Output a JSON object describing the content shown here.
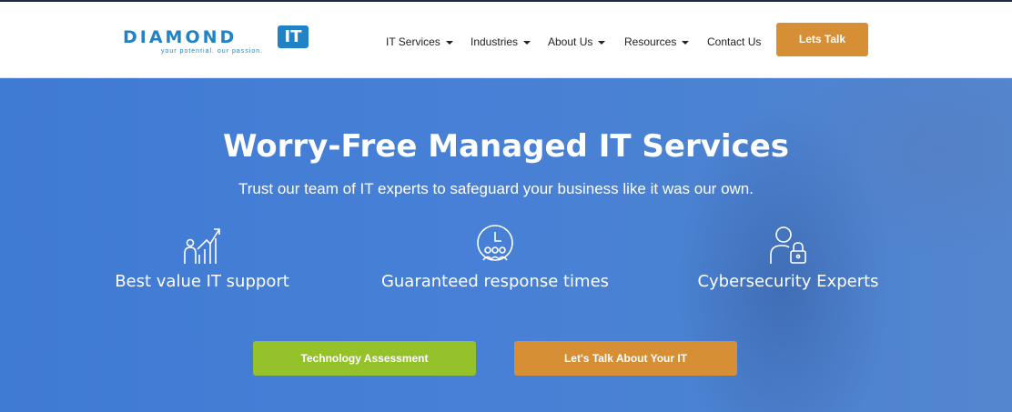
{
  "brand": {
    "logo_word": "DIAMOND",
    "logo_box": "IT",
    "tagline": "your potential. our passion.",
    "color_primary": "#2183c5"
  },
  "nav": {
    "items": [
      {
        "label": "IT Services",
        "dropdown": true
      },
      {
        "label": "Industries",
        "dropdown": true
      },
      {
        "label": "About Us",
        "dropdown": true
      },
      {
        "label": "Resources",
        "dropdown": true
      },
      {
        "label": "Contact Us",
        "dropdown": false
      }
    ],
    "cta_label": "Lets Talk"
  },
  "hero": {
    "title": "Worry-Free Managed IT Services",
    "subtitle": "Trust our team of IT experts to safeguard your business like it was our own.",
    "features": [
      {
        "icon": "growth-chart-icon",
        "label": "Best value IT support"
      },
      {
        "icon": "clock-team-icon",
        "label": "Guaranteed response times"
      },
      {
        "icon": "user-lock-icon",
        "label": "Cybersecurity Experts"
      }
    ],
    "buttons": {
      "primary_label": "Technology Assessment",
      "secondary_label": "Let's Talk About Your IT"
    }
  },
  "colors": {
    "hero_blue": "#4780d6",
    "cta_orange": "#d68f35",
    "cta_green": "#95c12a"
  }
}
